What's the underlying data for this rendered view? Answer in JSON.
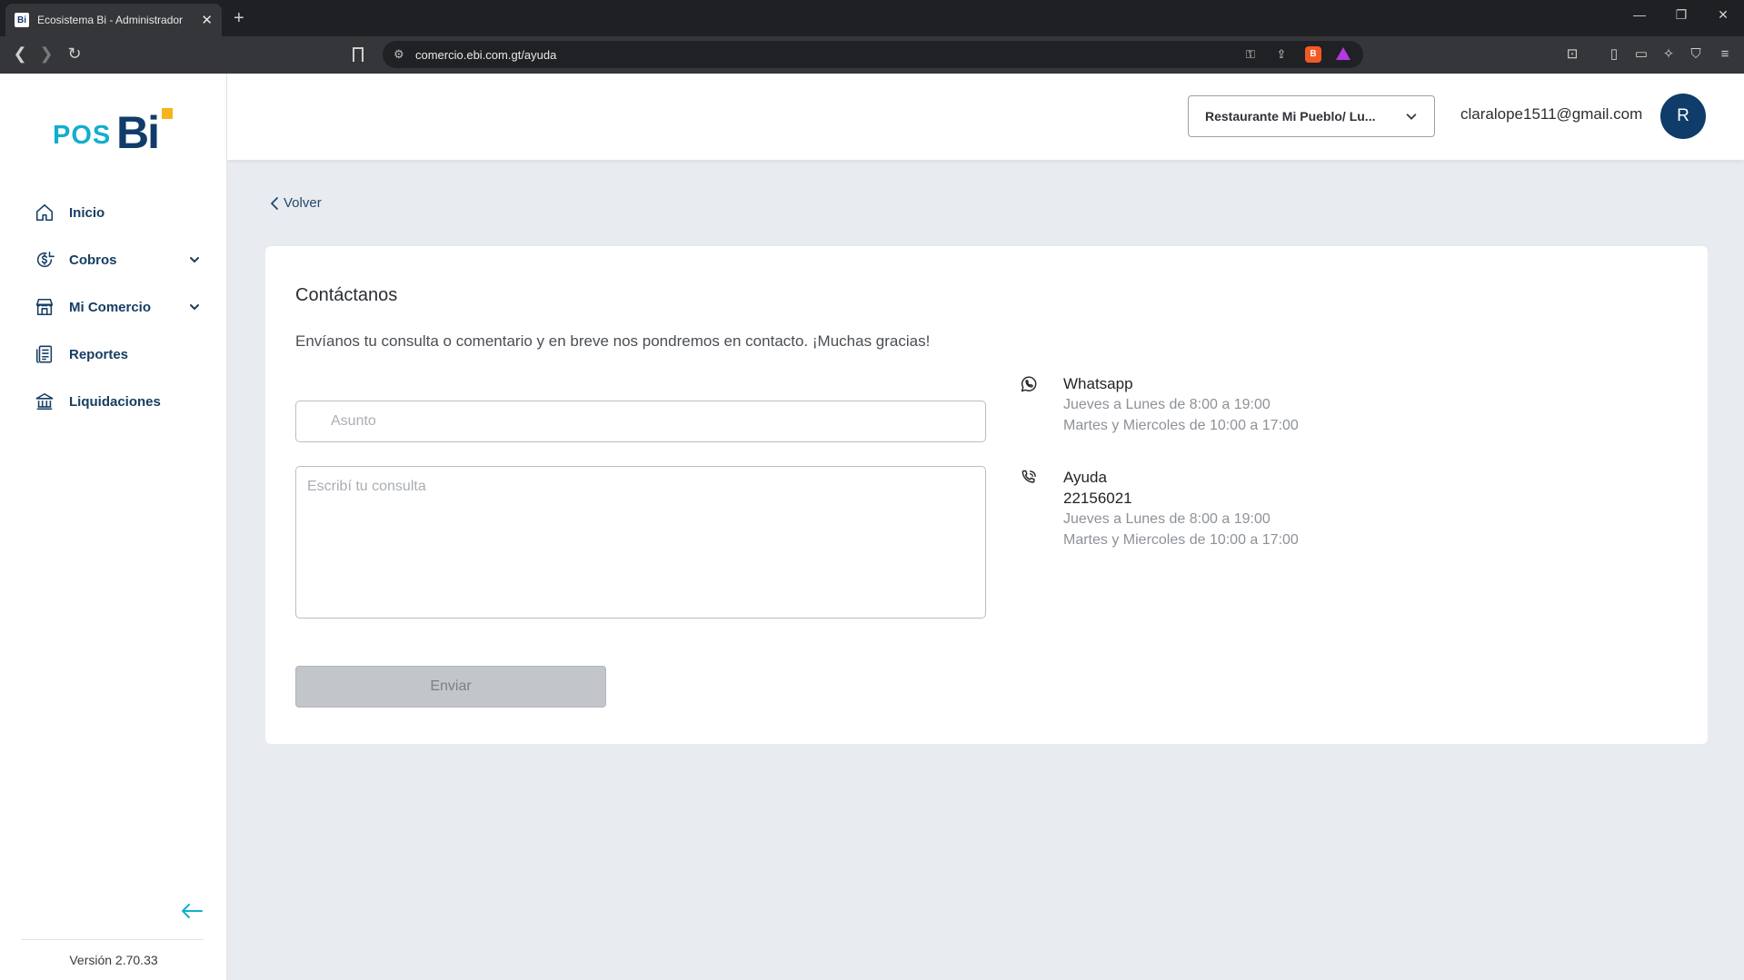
{
  "browser": {
    "tab_title": "Ecosistema Bi - Administrador",
    "tab_favicon": "Bi",
    "url": "comercio.ebi.com.gt/ayuda"
  },
  "brand": {
    "logo_pos": "POS",
    "logo_bi": "Bi",
    "primary_color": "#0f3c68",
    "accent_color": "#12aecd",
    "logo_square_color": "#f9b31a"
  },
  "sidebar": {
    "items": [
      {
        "label": "Inicio",
        "icon": "home-icon"
      },
      {
        "label": "Cobros",
        "icon": "payment-icon",
        "expandable": true
      },
      {
        "label": "Mi Comercio",
        "icon": "store-icon",
        "expandable": true
      },
      {
        "label": "Reportes",
        "icon": "reports-icon"
      },
      {
        "label": "Liquidaciones",
        "icon": "bank-icon"
      }
    ],
    "version": "Versión 2.70.33"
  },
  "header": {
    "store_selector": "Restaurante Mi Pueblo/ Lu...",
    "user_email": "claralope1511@gmail.com",
    "avatar_initial": "R"
  },
  "main": {
    "back_label": "Volver",
    "title": "Contáctanos",
    "description": "Envíanos tu consulta o comentario y en breve nos pondremos en contacto. ¡Muchas gracias!",
    "subject_placeholder": "Asunto",
    "query_placeholder": "Escribí tu consulta",
    "send_label": "Enviar",
    "contacts": {
      "whatsapp": {
        "title": "Whatsapp",
        "hours_1": "Jueves a Lunes de 8:00 a 19:00",
        "hours_2": "Martes y Miercoles de 10:00 a 17:00"
      },
      "help": {
        "title": "Ayuda",
        "number": "22156021",
        "hours_1": "Jueves a Lunes de 8:00 a 19:00",
        "hours_2": "Martes y Miercoles de 10:00 a 17:00"
      }
    }
  }
}
